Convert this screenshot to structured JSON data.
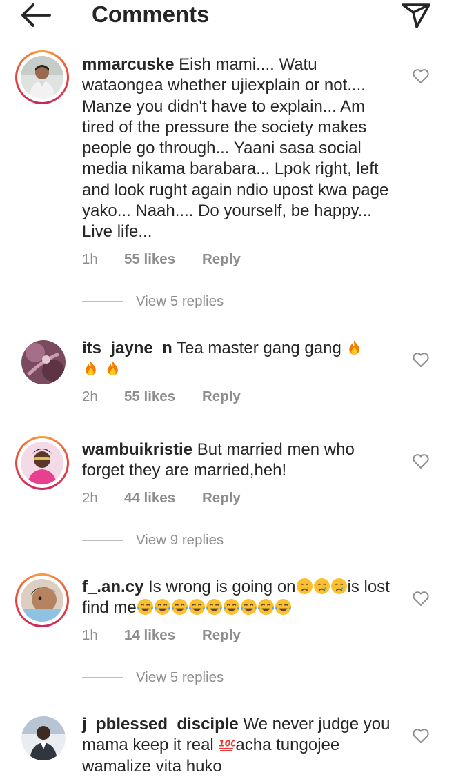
{
  "header": {
    "title": "Comments"
  },
  "comments": [
    {
      "username": "mmarcuske",
      "text": " Eish mami.... Watu wataongea whether ujiexplain or not.... Manze you didn't have to explain... Am tired of the pressure the society makes people go through... Yaani sasa social media nikama barabara... Lpok right, left and look rught again ndio upost kwa page yako... Naah.... Do yourself, be happy... Live life...",
      "time": "1h",
      "likes": "55 likes",
      "reply": "Reply",
      "view_replies": "View 5 replies"
    },
    {
      "username": "its_jayne_n",
      "text": " Tea master gang gang ",
      "emoji": "fire",
      "time": "2h",
      "likes": "55 likes",
      "reply": "Reply"
    },
    {
      "username": "wambuikristie",
      "text": " But married men who forget they are married,heh!",
      "time": "2h",
      "likes": "44 likes",
      "reply": "Reply",
      "view_replies": "View 9 replies"
    },
    {
      "username": "f_.an.cy",
      "text_a": " Is wrong is going on",
      "text_b": "is lost find me",
      "emoji_a": "crying-face",
      "emoji_b": "tears-of-joy",
      "time": "1h",
      "likes": "14 likes",
      "reply": "Reply",
      "view_replies": "View 5 replies"
    },
    {
      "username": "j_pblessed_disciple",
      "text_a": " We never judge you mama keep it real ",
      "text_b": "acha tungojee wamalize vita huko",
      "emoji": "hundred-points"
    }
  ],
  "colors": {
    "text": "#262626",
    "secondary": "#8e8e8e",
    "divider": "#bdbdbd",
    "story_ring_start": "#f9a13c",
    "story_ring_end": "#c8265f"
  }
}
